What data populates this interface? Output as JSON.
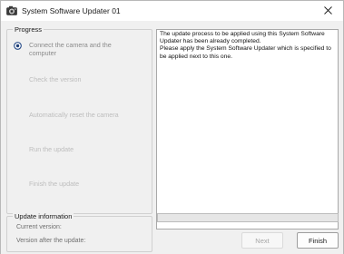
{
  "window": {
    "title": "System Software Updater 01",
    "icon": "camera-updater-app-icon",
    "close_icon": "close-icon"
  },
  "progress": {
    "legend": "Progress",
    "current_step_index": 0,
    "steps": [
      {
        "label_line1": "Connect the camera and the",
        "label_line2": "computer",
        "state": "current"
      },
      {
        "label_line1": "Check the version",
        "label_line2": "",
        "state": "pending"
      },
      {
        "label_line1": "Automatically reset the camera",
        "label_line2": "",
        "state": "pending"
      },
      {
        "label_line1": "Run the update",
        "label_line2": "",
        "state": "pending"
      },
      {
        "label_line1": "Finish the update",
        "label_line2": "",
        "state": "pending"
      }
    ]
  },
  "message": {
    "lines": [
      "The update process to be applied using this System Software",
      "Updater has been already completed.",
      "Please apply the System Software Updater which is specified to",
      "be applied next to this one."
    ]
  },
  "update_info": {
    "legend": "Update information",
    "current_version_label": "Current version:",
    "after_version_label": "Version after the update:",
    "current_version_value": "",
    "after_version_value": ""
  },
  "progress_bar": {
    "percent": 0,
    "fill_color": "#06b025"
  },
  "buttons": {
    "next_label": "Next",
    "next_enabled": false,
    "finish_label": "Finish",
    "finish_enabled": true
  }
}
